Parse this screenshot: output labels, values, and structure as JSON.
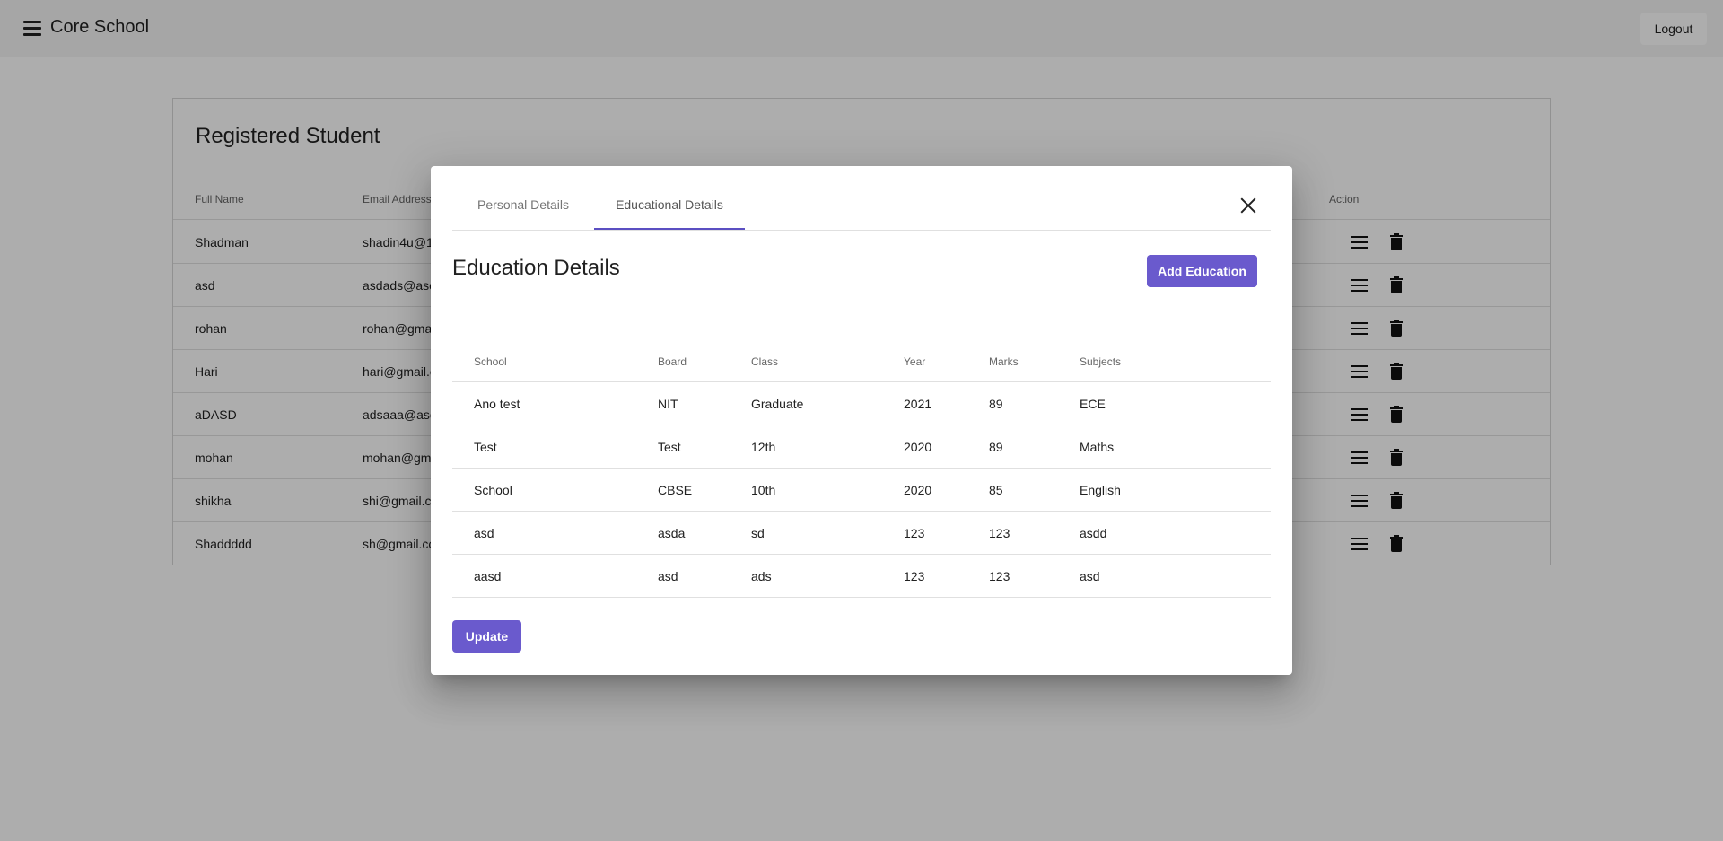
{
  "app": {
    "title": "Core School",
    "logout_label": "Logout"
  },
  "students": {
    "title": "Registered Student",
    "columns": [
      "Full Name",
      "Email Address",
      "Action"
    ],
    "rows": [
      {
        "name": "Shadman",
        "email": "shadin4u@1"
      },
      {
        "name": "asd",
        "email": "asdads@asc"
      },
      {
        "name": "rohan",
        "email": "rohan@gma"
      },
      {
        "name": "Hari",
        "email": "hari@gmail.c"
      },
      {
        "name": "aDASD",
        "email": "adsaaa@asc"
      },
      {
        "name": "mohan",
        "email": "mohan@gm"
      },
      {
        "name": "shikha",
        "email": "shi@gmail.c"
      },
      {
        "name": "Shaddddd",
        "email": "sh@gmail.cc"
      }
    ],
    "action_icons": [
      "list-icon",
      "delete-icon"
    ]
  },
  "dialog": {
    "tabs": [
      {
        "label": "Personal Details",
        "active": false
      },
      {
        "label": "Educational Details",
        "active": true
      }
    ],
    "title": "Education Details",
    "add_label": "Add Education",
    "update_label": "Update",
    "columns": [
      "School",
      "Board",
      "Class",
      "Year",
      "Marks",
      "Subjects"
    ],
    "rows": [
      {
        "school": "Ano test",
        "board": "NIT",
        "class": "Graduate",
        "year": "2021",
        "marks": "89",
        "subjects": "ECE"
      },
      {
        "school": "Test",
        "board": "Test",
        "class": "12th",
        "year": "2020",
        "marks": "89",
        "subjects": "Maths"
      },
      {
        "school": "School",
        "board": "CBSE",
        "class": "10th",
        "year": "2020",
        "marks": "85",
        "subjects": "English"
      },
      {
        "school": "asd",
        "board": "asda",
        "class": "sd",
        "year": "123",
        "marks": "123",
        "subjects": "asdd"
      },
      {
        "school": "aasd",
        "board": "asd",
        "class": "ads",
        "year": "123",
        "marks": "123",
        "subjects": "asd"
      }
    ]
  },
  "colors": {
    "accent": "#6a5acd",
    "tab_indicator": "#5b4fc2",
    "scrim": "rgba(0,0,0,0.32)"
  }
}
